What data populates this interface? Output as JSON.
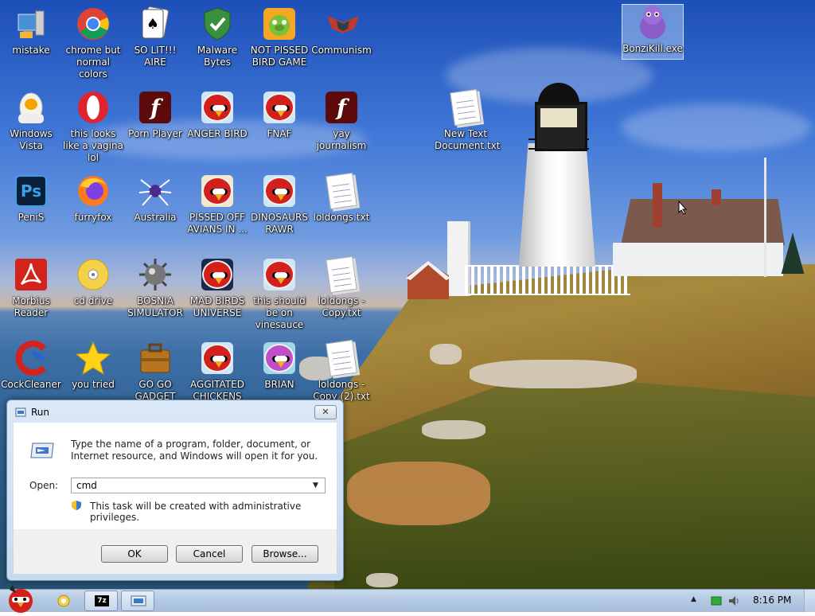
{
  "desktop": {
    "icons": [
      {
        "label": "mistake",
        "icon": "computer-icon"
      },
      {
        "label": "chrome but normal colors",
        "icon": "chrome-icon"
      },
      {
        "label": "SO LIT!!! AIRE",
        "icon": "solitaire-icon"
      },
      {
        "label": "Malware Bytes",
        "icon": "shield-icon"
      },
      {
        "label": "NOT PISSED BIRD GAME",
        "icon": "pig-icon"
      },
      {
        "label": "Communism",
        "icon": "emblem-icon"
      },
      {
        "label": "BonziKill.exe",
        "icon": "purple-gorilla-icon"
      },
      {
        "label": "Windows Vista",
        "icon": "egg-icon"
      },
      {
        "label": "this looks like a vagina lol",
        "icon": "opera-icon"
      },
      {
        "label": "Porn Player",
        "icon": "flash-icon"
      },
      {
        "label": "ANGER BIRD",
        "icon": "angry-bird-icon"
      },
      {
        "label": "FNAF",
        "icon": "angry-bird-icon"
      },
      {
        "label": "yay journalism",
        "icon": "flash-icon"
      },
      {
        "label": "New Text Document.txt",
        "icon": "text-document-icon"
      },
      {
        "label": "PeniS",
        "icon": "photoshop-icon"
      },
      {
        "label": "furryfox",
        "icon": "firefox-icon"
      },
      {
        "label": "Australia",
        "icon": "spider-solitaire-icon"
      },
      {
        "label": "PISSED OFF AVIANS IN ...",
        "icon": "angry-bird-seasons-icon"
      },
      {
        "label": "DINOSAURS RAWR",
        "icon": "angry-bird-icon"
      },
      {
        "label": "loldongs.txt",
        "icon": "text-document-icon"
      },
      {
        "label": "Morbius Reader",
        "icon": "adobe-reader-icon"
      },
      {
        "label": "cd drive",
        "icon": "cd-icon"
      },
      {
        "label": "BOSNIA SIMULATOR",
        "icon": "mine-icon"
      },
      {
        "label": "MAD BIRDS UNIVERSE",
        "icon": "angry-bird-space-icon"
      },
      {
        "label": "this should be on vinesauce",
        "icon": "angry-bird-icon"
      },
      {
        "label": "loldongs - Copy.txt",
        "icon": "text-document-icon"
      },
      {
        "label": "CockCleaner",
        "icon": "ccleaner-icon"
      },
      {
        "label": "you tried",
        "icon": "star-icon"
      },
      {
        "label": "GO GO GADGET",
        "icon": "briefcase-icon"
      },
      {
        "label": "AGGITATED CHICKENS I...",
        "icon": "angry-bird-icon"
      },
      {
        "label": "BRIAN",
        "icon": "angry-bird-hat-icon"
      },
      {
        "label": "loldongs - Copy (2).txt",
        "icon": "text-document-icon"
      }
    ]
  },
  "run_dialog": {
    "title": "Run",
    "description": "Type the name of a program, folder, document, or Internet resource, and Windows will open it for you.",
    "open_label": "Open:",
    "open_value": "cmd",
    "admin_note": "This task will be created with administrative privileges.",
    "ok_label": "OK",
    "cancel_label": "Cancel",
    "browse_label": "Browse...",
    "close_glyph": "✕"
  },
  "taskbar": {
    "clock": "8:16 PM",
    "dropdown_glyph": "▼",
    "tray_arrow": "▲",
    "pinned": [
      "explorer-icon",
      "7zip-icon",
      "run-window-icon"
    ],
    "pinned_labels": {
      "zip": "7z"
    }
  },
  "colors": {
    "taskbar": "#b2c8e2",
    "dialog_frame": "#c8d9ef"
  }
}
